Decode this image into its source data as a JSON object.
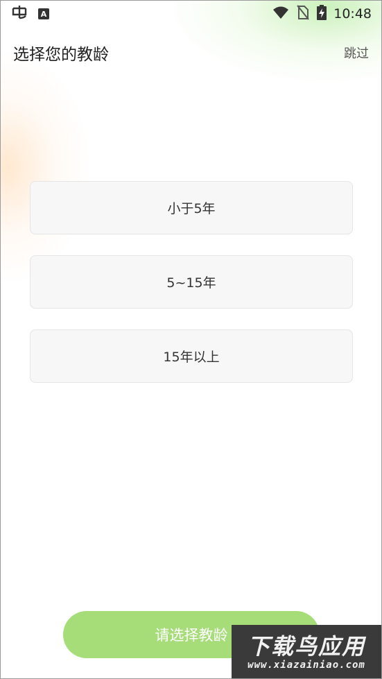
{
  "status_bar": {
    "time": "10:48",
    "left_icons": [
      "bug-app-icon",
      "a-app-icon"
    ],
    "right_icons": [
      "wifi-icon",
      "no-sim-icon",
      "battery-charging-icon"
    ],
    "a_app_letter": "A"
  },
  "header": {
    "title": "选择您的教龄",
    "skip_label": "跳过"
  },
  "options": [
    {
      "label": "小于5年"
    },
    {
      "label": "5~15年"
    },
    {
      "label": "15年以上"
    }
  ],
  "submit": {
    "label": "请选择教龄",
    "color": "#a6dd79"
  },
  "watermark": {
    "title": "下载鸟应用",
    "url": "www.xiazainiao.com"
  }
}
